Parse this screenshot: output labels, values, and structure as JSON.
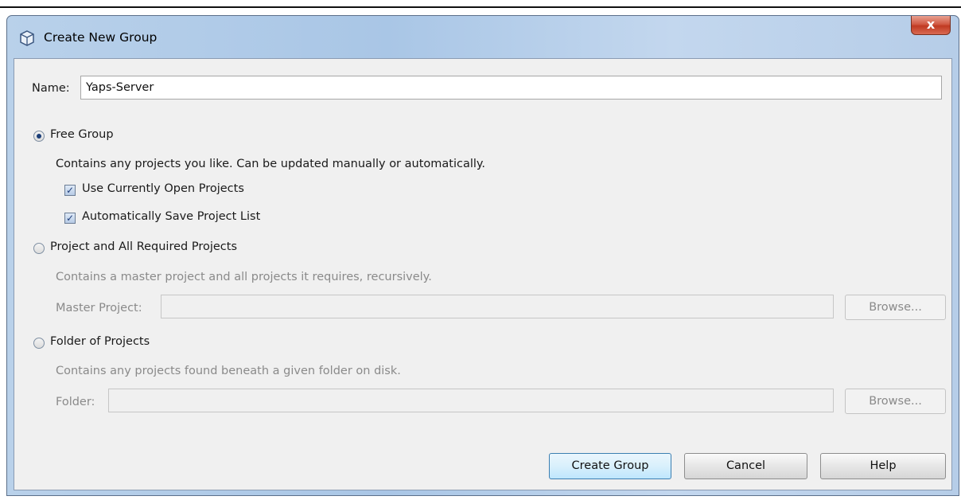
{
  "window": {
    "title": "Create New Group",
    "close_glyph": "x"
  },
  "name_field": {
    "label": "Name:",
    "value": "Yaps-Server"
  },
  "free_group": {
    "label": "Free Group",
    "selected": true,
    "description": "Contains any projects you like. Can be updated manually or automatically.",
    "use_open_projects": {
      "label": "Use Currently Open Projects",
      "checked": true
    },
    "auto_save": {
      "label": "Automatically Save Project List",
      "checked": true
    }
  },
  "required_projects": {
    "label": "Project and All Required Projects",
    "selected": false,
    "description": "Contains a master project and all projects it requires, recursively.",
    "master_label": "Master Project:",
    "master_value": "",
    "browse_label": "Browse..."
  },
  "folder_projects": {
    "label": "Folder of Projects",
    "selected": false,
    "description": "Contains any projects found beneath a given folder on disk.",
    "folder_label": "Folder:",
    "folder_value": "",
    "browse_label": "Browse..."
  },
  "buttons": {
    "create": "Create Group",
    "cancel": "Cancel",
    "help": "Help"
  },
  "colors": {
    "titlebar": "#b9d1ea",
    "dialog_bg": "#f0f0f0",
    "close": "#c9452e"
  },
  "icons": {
    "title": "cube-icon",
    "close": "close-icon",
    "check": "checkmark-icon",
    "radio": "radio-dot-icon"
  }
}
